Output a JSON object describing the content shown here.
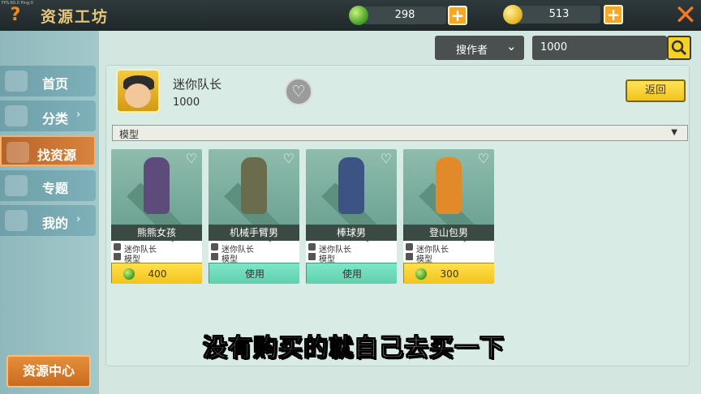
{
  "topbar": {
    "fps_text": "FPS:60.0 Ping:0",
    "help_icon": "?",
    "title": "资源工坊",
    "gems": "298",
    "coins": "513",
    "plus_label": "+",
    "close_icon": "✕"
  },
  "sidebar": {
    "items": [
      {
        "label": "首页",
        "icon": "home-icon"
      },
      {
        "label": "分类",
        "icon": "category-icon",
        "chevron": "›"
      },
      {
        "label": "找资源",
        "icon": "search-icon"
      },
      {
        "label": "专题",
        "icon": "topic-icon"
      },
      {
        "label": "我的",
        "icon": "cat-icon",
        "chevron": "›"
      }
    ],
    "center_button": "资源中心"
  },
  "search": {
    "dropdown_value": "搜作者",
    "query": "1000"
  },
  "author": {
    "name": "迷你队长",
    "id": "1000",
    "back_label": "返回"
  },
  "filter": {
    "label": "模型"
  },
  "cards": [
    {
      "name": "熊熊女孩",
      "author": "迷你队长",
      "type": "模型",
      "action": "400",
      "kind": "price",
      "fig_color": "#5d4b7c"
    },
    {
      "name": "机械手臂男",
      "author": "迷你队长",
      "type": "模型",
      "action": "使用",
      "kind": "use",
      "fig_color": "#6b6b4e"
    },
    {
      "name": "棒球男",
      "author": "迷你队长",
      "type": "模型",
      "action": "使用",
      "kind": "use",
      "fig_color": "#3b5483"
    },
    {
      "name": "登山包男",
      "author": "迷你队长",
      "type": "模型",
      "action": "300",
      "kind": "price",
      "fig_color": "#e28a2a"
    }
  ],
  "subtitle": "没有购买的就自己去买一下"
}
